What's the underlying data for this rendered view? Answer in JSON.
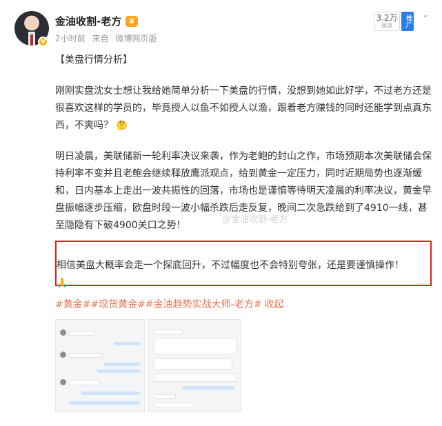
{
  "post": {
    "author": "金油收割-老方",
    "time": "2小时前",
    "from_label": "来自",
    "source": "微博网页版",
    "reads_count": "3.2万",
    "reads_label": "阅读",
    "promote_label": "推广"
  },
  "content": {
    "title": "【美盘行情分析】",
    "para1": "刚刚实盘沈女士想让我给她简单分析一下美盘的行情，没想到她如此好学，不过老方还是很喜欢这样的学员的，毕竟授人以鱼不如授人以渔，跟着老方赚钱的同时还能学到点真东西，不爽吗？",
    "para1_emoji": "🤔",
    "para2": "明日凌晨，美联储新一轮利率决议来袭，作为老鲍的封山之作，市场预期本次美联储会保持利率不变并且老鲍会继续释放鹰派观点，给到黄金一定压力，同时近期局势也逐渐缓和，日内基本上走出一波共振性的回落，市场也是谨慎等待明天凌晨的利率决议，黄金早盘振幅逐步压缩，欧盘时段一波小幅杀跌后走反复，晚间二次急跌给到了4910一线，甚至隐隐有下破4900关口之势！",
    "para3": "相信美盘大概率会走一个探底回升，不过幅度也不会特别夸张，还是要谨慎操作！",
    "para3_emoji": "🙏",
    "hashtags": "#黄金##现货黄金##金油趋势实战大师-老方#",
    "collapse": "收起"
  },
  "watermark": "@金油收割-老方",
  "icons": {
    "verified": "verified-badge-icon",
    "crown": "crown-icon",
    "chevron": "chevron-down-icon"
  },
  "colors": {
    "link": "#eb7350",
    "highlight_border": "#e02020",
    "promote_bg": "#2b7de9",
    "verified": "#f7b500"
  }
}
